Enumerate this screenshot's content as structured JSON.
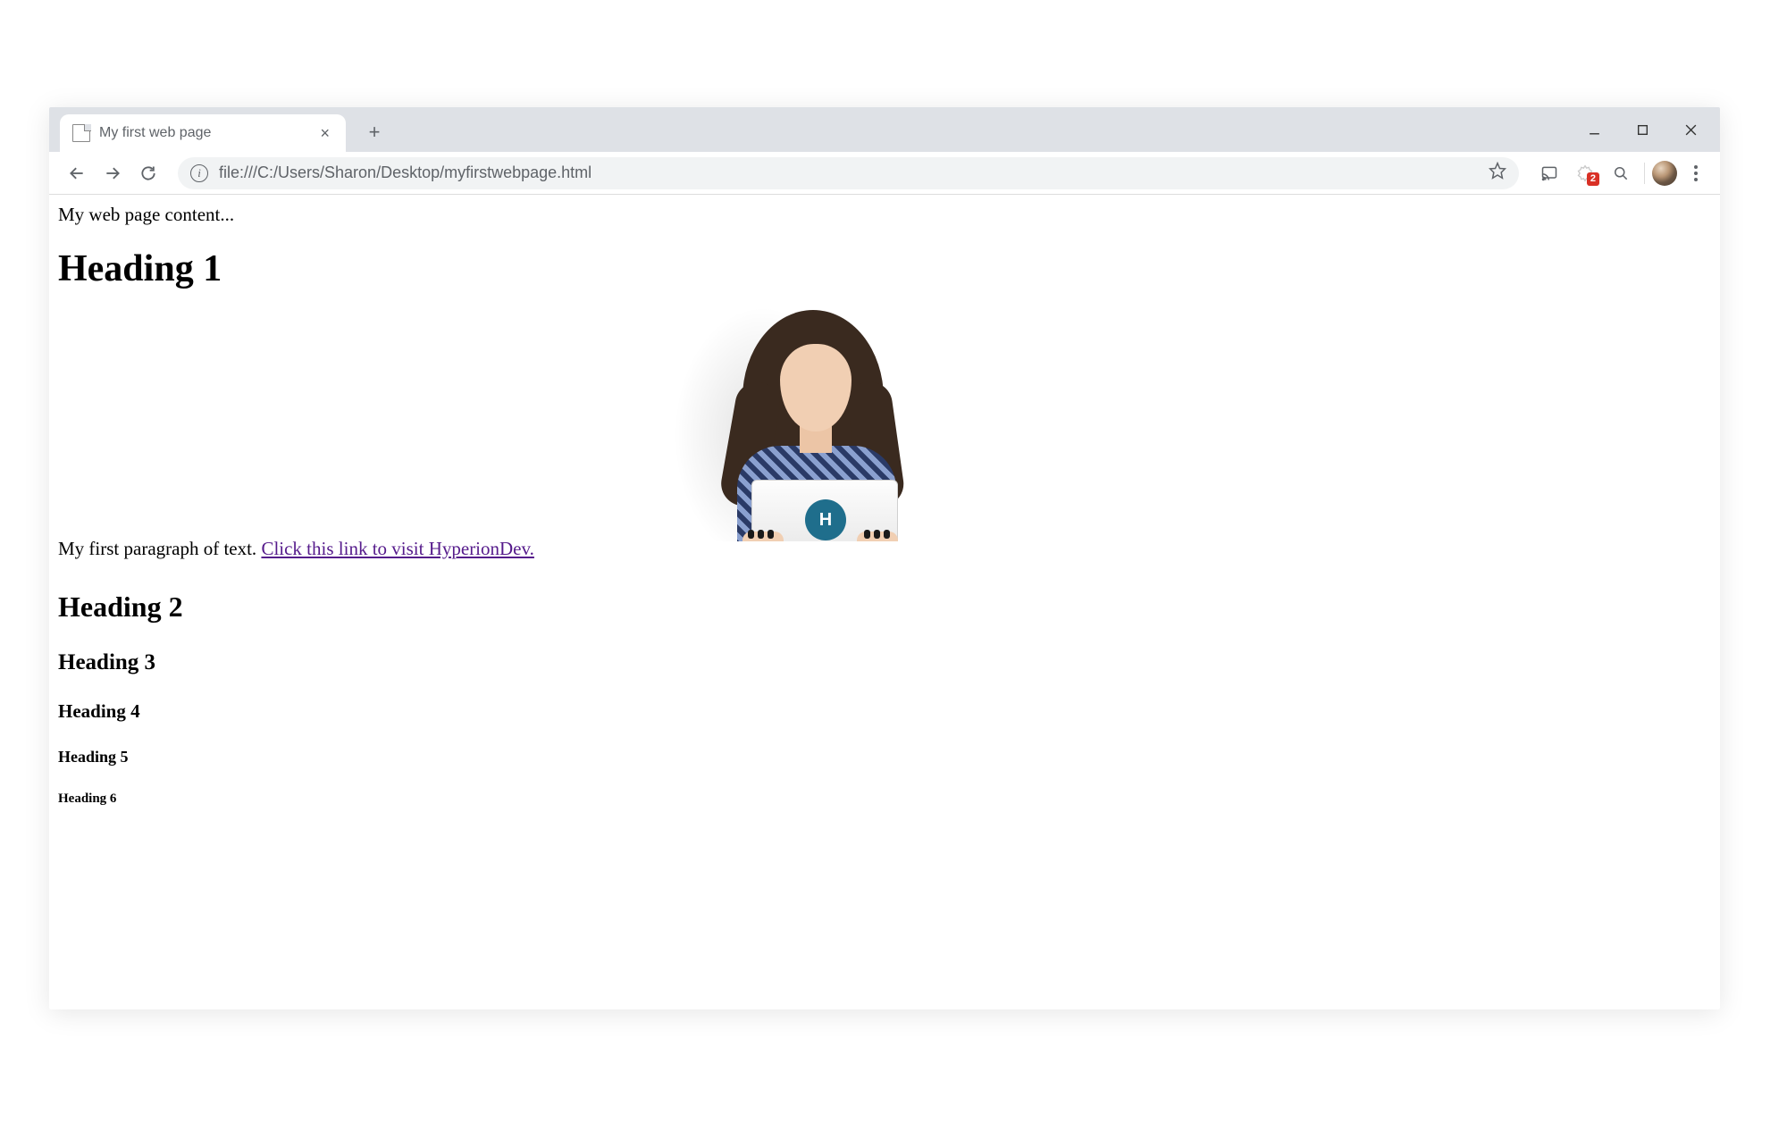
{
  "browser": {
    "tab_title": "My first web page",
    "url": "file:///C:/Users/Sharon/Desktop/myfirstwebpage.html",
    "notification_count": "2"
  },
  "page": {
    "intro_text": "My web page content...",
    "h1": "Heading 1",
    "paragraph_prefix": "My first paragraph of text. ",
    "link_text": "Click this link to visit HyperionDev.",
    "h2": "Heading 2",
    "h3": "Heading 3",
    "h4": "Heading 4",
    "h5": "Heading 5",
    "h6": "Heading 6",
    "image_logo_letter": "H"
  }
}
